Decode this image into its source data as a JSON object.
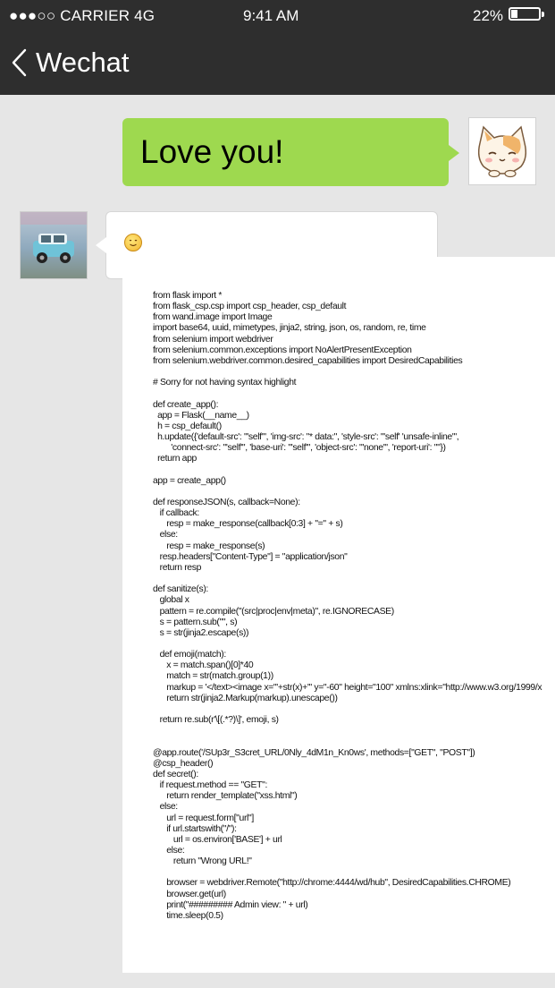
{
  "status_bar": {
    "carrier": "●●●○○ CARRIER 4G",
    "time": "9:41  AM",
    "battery": "22%",
    "battery_level": 0.22
  },
  "nav": {
    "back_label": "Wechat",
    "back_icon": "chevron-left-icon"
  },
  "messages": {
    "outgoing": {
      "text": "Love you!",
      "bubble_color": "#9ed94f"
    },
    "incoming": {
      "emoji_icon": "smiling-face-icon"
    }
  },
  "code_lines": [
    "from flask import *",
    "from flask_csp.csp import csp_header, csp_default",
    "from wand.image import Image",
    "import base64, uuid, mimetypes, jinja2, string, json, os, random, re, time",
    "from selenium import webdriver",
    "from selenium.common.exceptions import NoAlertPresentException",
    "from selenium.webdriver.common.desired_capabilities import DesiredCapabilities",
    "",
    "# Sorry for not having syntax highlight",
    "",
    "def create_app():",
    "  app = Flask(__name__)",
    "  h = csp_default()",
    "  h.update({'default-src': \"'self'\", 'img-src': \"* data:\", 'style-src': \"'self' 'unsafe-inline'\",",
    "        'connect-src': \"'self'\", 'base-uri': \"'self'\", 'object-src': \"'none'\", 'report-uri': \"\"})",
    "  return app",
    "",
    "app = create_app()",
    "",
    "def responseJSON(s, callback=None):",
    "   if callback:",
    "      resp = make_response(callback[0:3] + \"=\" + s)",
    "   else:",
    "      resp = make_response(s)",
    "   resp.headers[\"Content-Type\"] = \"application/json\"",
    "   return resp",
    "",
    "def sanitize(s):",
    "   global x",
    "   pattern = re.compile(\"(src|proc|env|meta)\", re.IGNORECASE)",
    "   s = pattern.sub(\"\", s)",
    "   s = str(jinja2.escape(s))",
    "",
    "   def emoji(match):",
    "      x = match.span()[0]*40",
    "      match = str(match.group(1))",
    "      markup = '</text><image x=\"'+str(x)+'\" y=\"-60\" height=\"100\" xmlns:xlink=\"http://www.w3.org/1999/x",
    "      return str(jinja2.Markup(markup).unescape())",
    "",
    "   return re.sub(r'\\[(.*?)\\]', emoji, s)",
    "",
    "",
    "@app.route('/SUp3r_S3cret_URL/0Nly_4dM1n_Kn0ws', methods=[\"GET\", \"POST\"])",
    "@csp_header()",
    "def secret():",
    "   if request.method == \"GET\":",
    "      return render_template(\"xss.html\")",
    "   else:",
    "      url = request.form[\"url\"]",
    "      if url.startswith(\"/\"):",
    "         url = os.environ['BASE'] + url",
    "      else:",
    "         return \"Wrong URL!\"",
    "",
    "      browser = webdriver.Remote(\"http://chrome:4444/wd/hub\", DesiredCapabilities.CHROME)",
    "      browser.get(url)",
    "      print(\"######### Admin view: \" + url)",
    "      time.sleep(0.5)"
  ]
}
